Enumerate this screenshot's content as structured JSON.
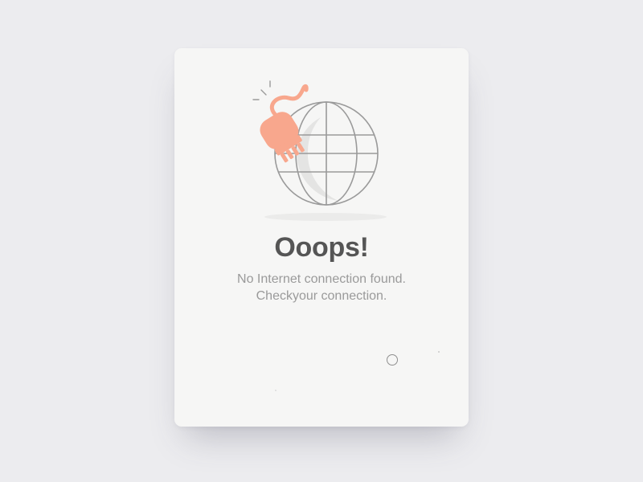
{
  "dialog": {
    "title": "Ooops!",
    "message_line1": "No Internet connection found.",
    "message_line2": "Checkyour connection.",
    "illustration": {
      "globe_icon": "globe-icon",
      "plug_icon": "unplugged-cable-icon",
      "plug_color": "#f8a78d",
      "line_color": "#9a9a9a"
    }
  },
  "colors": {
    "background": "#ececef",
    "card": "#f6f6f5",
    "title": "#555555",
    "message": "#9a9a9a",
    "accent": "#f8a78d"
  }
}
